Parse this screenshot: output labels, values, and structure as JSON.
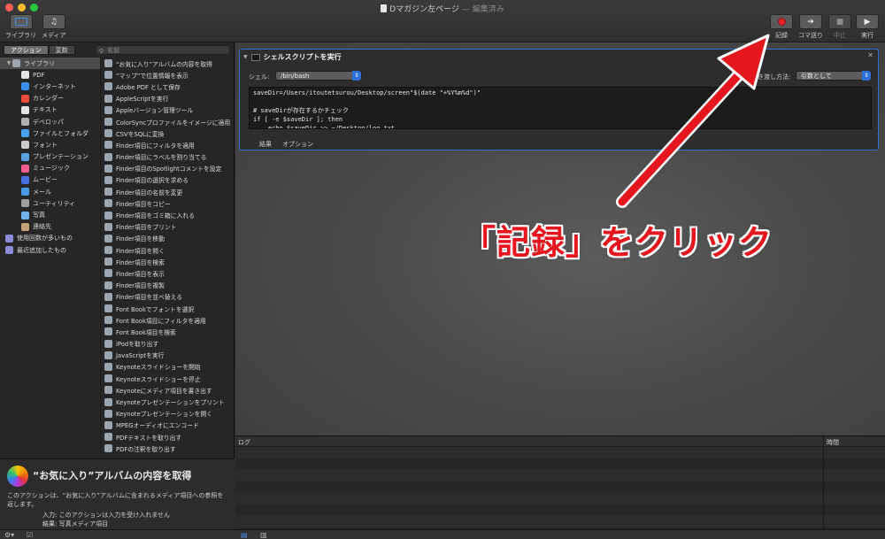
{
  "window": {
    "title": "Dマガジン左ページ",
    "subtitle": " — 編集済み"
  },
  "toolbar": {
    "library_label": "ライブラリ",
    "media_label": "メディア",
    "record_label": "記録",
    "step_label": "コマ送り",
    "stop_label": "中止",
    "run_label": "実行"
  },
  "sidebar": {
    "tab_actions": "アクション",
    "tab_variables": "変数",
    "search_placeholder": "名前",
    "categories": [
      {
        "label": "ライブラリ",
        "color": "#9aa6b2"
      },
      {
        "label": "PDF",
        "color": "#e5e5e5"
      },
      {
        "label": "インターネット",
        "color": "#3a8fe8"
      },
      {
        "label": "カレンダー",
        "color": "#e94b3c"
      },
      {
        "label": "テキスト",
        "color": "#e5e5e5"
      },
      {
        "label": "デベロッパ",
        "color": "#b0b0b0"
      },
      {
        "label": "ファイルとフォルダ",
        "color": "#4aa3f0"
      },
      {
        "label": "フォント",
        "color": "#cccccc"
      },
      {
        "label": "プレゼンテーション",
        "color": "#5aa0e0"
      },
      {
        "label": "ミュージック",
        "color": "#f25d8e"
      },
      {
        "label": "ムービー",
        "color": "#4a6fe0"
      },
      {
        "label": "メール",
        "color": "#4a9ae8"
      },
      {
        "label": "ユーティリティ",
        "color": "#a0a0a0"
      },
      {
        "label": "写真",
        "color": "#6fb3ea"
      },
      {
        "label": "連絡先",
        "color": "#c6a47a"
      },
      {
        "label": "使用回数が多いもの",
        "color": "#8c8cd8"
      },
      {
        "label": "最近追加したもの",
        "color": "#8c8cd8"
      }
    ],
    "actions": [
      "“お気に入り”アルバムの内容を取得",
      "“マップ”で位置情報を表示",
      "Adobe PDF として保存",
      "AppleScriptを実行",
      "Appleバージョン管理ツール",
      "ColorSyncプロファイルをイメージに適用",
      "CSVをSQLに変換",
      "Finder項目にフィルタを適用",
      "Finder項目にラベルを割り当てる",
      "Finder項目のSpotlightコメントを設定",
      "Finder項目の選択を求める",
      "Finder項目の名前を変更",
      "Finder項目をコピー",
      "Finder項目をゴミ箱に入れる",
      "Finder項目をプリント",
      "Finder項目を移動",
      "Finder項目を開く",
      "Finder項目を検索",
      "Finder項目を表示",
      "Finder項目を複製",
      "Finder項目を並べ替える",
      "Font Bookでフォントを選択",
      "Font Book項目にフィルタを適用",
      "Font Book項目を検索",
      "iPodを取り出す",
      "JavaScriptを実行",
      "Keynoteスライドショーを開始",
      "Keynoteスライドショーを停止",
      "Keynoteにメディア項目を書き出す",
      "Keynoteプレゼンテーションをプリント",
      "Keynoteプレゼンテーションを開く",
      "MPEGオーディオにエンコード",
      "PDFテキストを取り出す",
      "PDFの注釈を取り出す"
    ]
  },
  "info": {
    "title": "“お気に入り”アルバムの内容を取得",
    "description": "このアクションは、“お気に入り”アルバムに含まれるメディア項目への参照を返します。",
    "input_label": "入力:",
    "input_value": "このアクションは入力を受け入れません",
    "result_label": "結果:",
    "result_value": "写真メディア項目"
  },
  "action_card": {
    "title": "シェルスクリプトを実行",
    "shell_label": "シェル:",
    "shell_value": "/bin/bash",
    "pass_input_label": "き渡し方法:",
    "pass_input_value": "引数として",
    "code_lines": [
      "saveDir=/Users/itoutetsurou/Desktop/screen\"$(date \"+%Y%m%d\")\"",
      "",
      "# saveDirが存在するかチェック",
      "if [ -e $saveDir ]; then",
      "    echo $saveDir >> ~/Desktop/log.txt"
    ],
    "tab_results": "結果",
    "tab_options": "オプション"
  },
  "log": {
    "col_log": "ログ",
    "col_time": "時間"
  },
  "annotation": {
    "text": "「記録」をクリック",
    "color": "#e6161e"
  }
}
